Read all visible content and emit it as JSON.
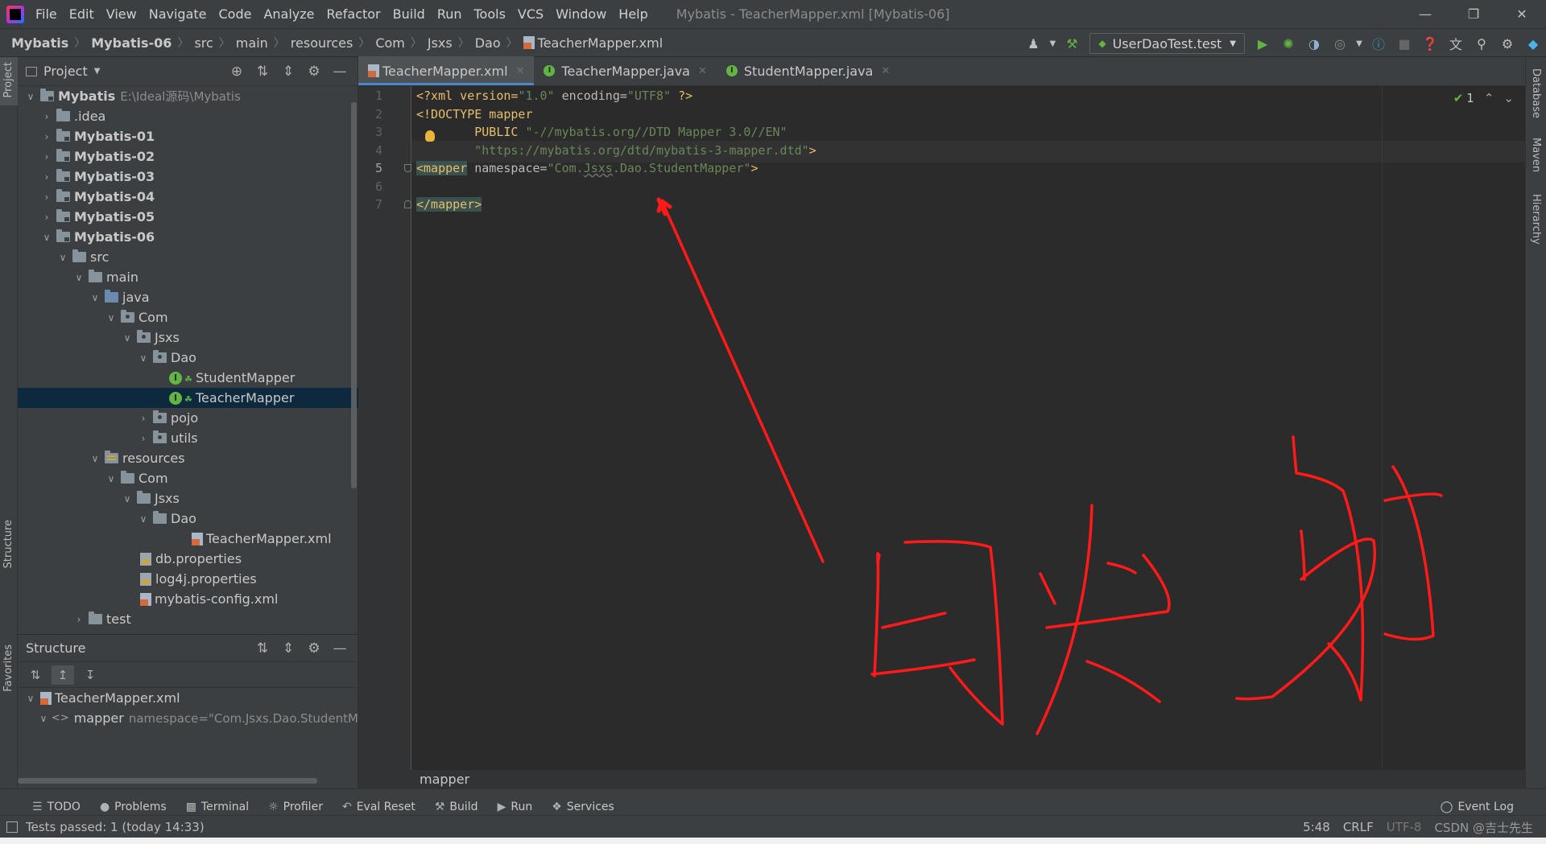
{
  "menubar": {
    "items": [
      "File",
      "Edit",
      "View",
      "Navigate",
      "Code",
      "Analyze",
      "Refactor",
      "Build",
      "Run",
      "Tools",
      "VCS",
      "Window",
      "Help"
    ],
    "title": "Mybatis - TeacherMapper.xml [Mybatis-06]"
  },
  "navbar": {
    "crumbs": [
      "Mybatis",
      "Mybatis-06",
      "src",
      "main",
      "resources",
      "Com",
      "Jsxs",
      "Dao",
      "TeacherMapper.xml"
    ],
    "run_config": "UserDaoTest.test"
  },
  "project_panel": {
    "title": "Project",
    "tree": [
      {
        "label": "Mybatis",
        "extra": "E:\\Ideal源码\\Mybatis"
      },
      {
        "label": ".idea"
      },
      {
        "label": "Mybatis-01"
      },
      {
        "label": "Mybatis-02"
      },
      {
        "label": "Mybatis-03"
      },
      {
        "label": "Mybatis-04"
      },
      {
        "label": "Mybatis-05"
      },
      {
        "label": "Mybatis-06"
      },
      {
        "label": "src"
      },
      {
        "label": "main"
      },
      {
        "label": "java"
      },
      {
        "label": "Com"
      },
      {
        "label": "Jsxs"
      },
      {
        "label": "Dao"
      },
      {
        "label": "StudentMapper"
      },
      {
        "label": "TeacherMapper"
      },
      {
        "label": "pojo"
      },
      {
        "label": "utils"
      },
      {
        "label": "resources"
      },
      {
        "label": "Com"
      },
      {
        "label": "Jsxs"
      },
      {
        "label": "Dao"
      },
      {
        "label": "TeacherMapper.xml"
      },
      {
        "label": "db.properties"
      },
      {
        "label": "log4j.properties"
      },
      {
        "label": "mybatis-config.xml"
      },
      {
        "label": "test"
      }
    ]
  },
  "structure_panel": {
    "title": "Structure",
    "root": "TeacherMapper.xml",
    "child": "mapper",
    "child_attr": "namespace=\"Com.Jsxs.Dao.StudentM"
  },
  "editor": {
    "tabs": [
      "TeacherMapper.xml",
      "TeacherMapper.java",
      "StudentMapper.java"
    ],
    "line_numbers": [
      "1",
      "2",
      "3",
      "4",
      "5",
      "6",
      "7"
    ],
    "lines": {
      "l1_a": "<?xml version=",
      "l1_b": "\"1.0\"",
      "l1_c": " encoding=",
      "l1_d": "\"UTF8\"",
      "l1_e": " ?>",
      "l2": "<!DOCTYPE mapper",
      "l3_a": "        PUBLIC ",
      "l3_b": "\"-//mybatis.org//DTD Mapper 3.0//EN\"",
      "l4_a": "        ",
      "l4_b": "\"https://mybatis.org/dtd/mybatis-3-mapper.dtd\"",
      "l4_c": ">",
      "l5_a": "<mapper",
      "l5_b": " namespace=",
      "l5_c": "\"Com.",
      "l5_d": "Jsxs",
      "l5_e": ".Dao.StudentMapper\"",
      "l5_f": ">",
      "l7": "</mapper>"
    },
    "inspection_count": "1",
    "breadcrumb": "mapper"
  },
  "stripes": {
    "left": [
      "Project",
      "Structure",
      "Favorites"
    ],
    "right": [
      "Database",
      "Maven",
      "Hierarchy"
    ]
  },
  "toolwindows": [
    "TODO",
    "Problems",
    "Terminal",
    "Profiler",
    "Eval Reset",
    "Build",
    "Run",
    "Services"
  ],
  "event_log": "Event Log",
  "status": {
    "message": "Tests passed: 1 (today 14:33)",
    "position": "5:48",
    "line_sep": "CRLF",
    "encoding": "UTF-8",
    "watermark": "CSDN @吉士先生"
  },
  "colors": {
    "accent": "#4a88c7",
    "annotation": "#ff1a1a",
    "selection": "#0d293e"
  }
}
